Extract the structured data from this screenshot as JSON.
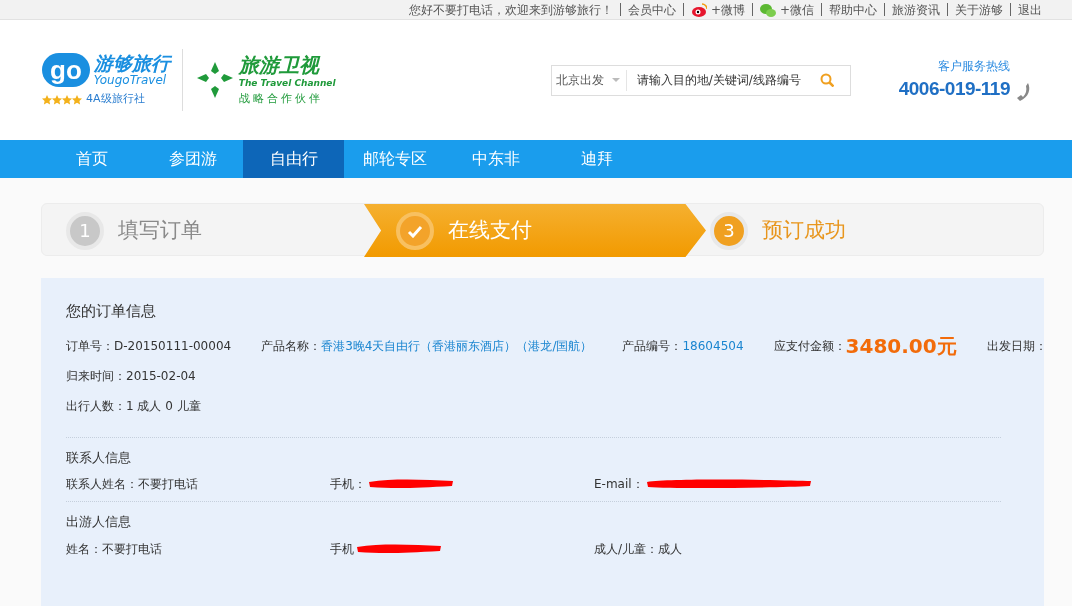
{
  "top_bar": {
    "greeting": "您好不要打电话，欢迎来到游够旅行！",
    "links": [
      "会员中心",
      "+微博",
      "+微信",
      "帮助中心",
      "旅游资讯",
      "关于游够",
      "退出"
    ]
  },
  "logo": {
    "mark": "go",
    "brand": "游够旅行",
    "brand_en": "YougoTravel",
    "rating": "4A级旅行社"
  },
  "partner": {
    "name": "旅游卫视",
    "name_en": "The Travel Channel",
    "tagline": "战略合作伙伴"
  },
  "search": {
    "city": "北京出发",
    "placeholder": "请输入目的地/关键词/线路编号"
  },
  "hotline": {
    "label": "客户服务热线",
    "number": "4006-019-119"
  },
  "nav": [
    {
      "label": "首页",
      "selected": false
    },
    {
      "label": "参团游",
      "selected": false
    },
    {
      "label": "自由行",
      "selected": true
    },
    {
      "label": "邮轮专区",
      "selected": false
    },
    {
      "label": "中东非",
      "selected": false
    },
    {
      "label": "迪拜",
      "selected": false
    }
  ],
  "steps": [
    {
      "number": "1",
      "label": "填写订单",
      "completed": true,
      "selected": false
    },
    {
      "label": "在线支付",
      "completed": false,
      "selected": true
    },
    {
      "number": "3",
      "label": "预订成功",
      "completed": false,
      "selected": false
    }
  ],
  "order": {
    "title": "您的订单信息",
    "rows": [
      [
        {
          "label": "订单号：",
          "value": "D-20150111-00004",
          "kind": "plain"
        },
        {
          "label": "产品名称：",
          "value": "香港3晚4天自由行（香港丽东酒店）（港龙/国航）",
          "kind": "link"
        },
        {
          "label": "产品编号：",
          "value": "18604504",
          "kind": "link"
        },
        {
          "label": "应支付金额：",
          "value": "3480.00元",
          "kind": "amount"
        },
        {
          "label": "出发日期：",
          "kind": "plain"
        }
      ],
      [
        {
          "label": "归来时间：",
          "value": "2015-02-04",
          "kind": "plain"
        }
      ],
      [
        {
          "label": "出行人数：",
          "value": "1 成人 0 儿童",
          "kind": "plain"
        }
      ]
    ]
  },
  "sections": [
    {
      "title": "联系人信息",
      "fields": [
        {
          "label": "联系人姓名：",
          "value": "不要打电话",
          "redacted": false
        },
        {
          "label": "手机：",
          "redacted": true
        },
        {
          "label": "E-mail：",
          "redacted": true
        }
      ]
    },
    {
      "title": "出游人信息",
      "fields": [
        {
          "label": "姓名：",
          "value": "不要打电话",
          "redacted": false
        },
        {
          "label": "手机",
          "redacted": true
        },
        {
          "label": "成人/儿童：",
          "value": "成人",
          "redacted": false
        }
      ]
    }
  ]
}
